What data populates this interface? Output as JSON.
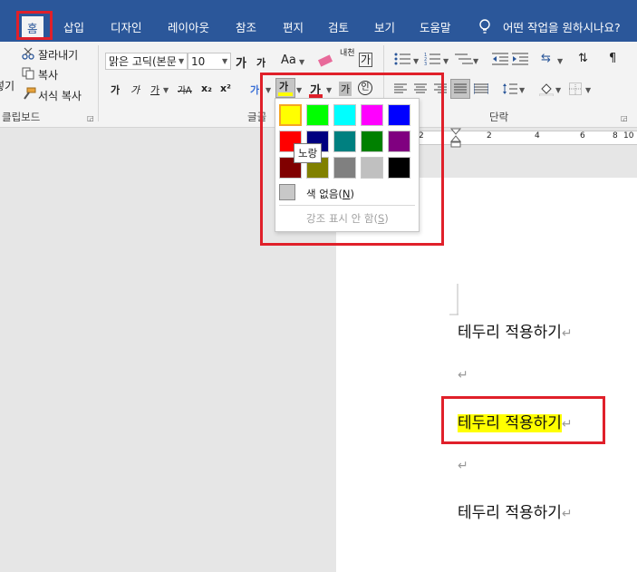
{
  "tabs": [
    {
      "label": "홈",
      "active": true
    },
    {
      "label": "삽입"
    },
    {
      "label": "디자인"
    },
    {
      "label": "레이아웃"
    },
    {
      "label": "참조"
    },
    {
      "label": "편지"
    },
    {
      "label": "검토"
    },
    {
      "label": "보기"
    },
    {
      "label": "도움말"
    }
  ],
  "tell_me": "어떤 작업을 원하시나요?",
  "clipboard": {
    "paste_partial": "넣기",
    "cut": "잘라내기",
    "copy": "복사",
    "format_painter": "서식 복사",
    "group_label": "클립보드"
  },
  "font": {
    "font_name": "맑은 고딕(본문",
    "font_size": "10",
    "group_label": "글꼴",
    "grow_label": "가",
    "shrink_label": "가",
    "case_label": "Aa",
    "bold": "가",
    "italic": "가",
    "underline": "가",
    "strike": "가Ꭺ",
    "subscript": "x₂",
    "superscript": "x²",
    "text_effect": "가",
    "highlight": "가",
    "font_color": "가",
    "char_shade": "가",
    "enclose": "인",
    "phonetic": "내천",
    "border_char": "가"
  },
  "paragraph": {
    "group_label": "단락"
  },
  "ruler_numbers": [
    "2",
    "2",
    "4",
    "6",
    "8",
    "10"
  ],
  "highlight_menu": {
    "colors": [
      {
        "name": "노랑",
        "hex": "#ffff00"
      },
      {
        "name": "밝은 녹색",
        "hex": "#00ff00"
      },
      {
        "name": "옥색",
        "hex": "#00ffff"
      },
      {
        "name": "분홍",
        "hex": "#ff00ff"
      },
      {
        "name": "파랑",
        "hex": "#0000ff"
      },
      {
        "name": "빨강",
        "hex": "#ff0000"
      },
      {
        "name": "진한 파랑",
        "hex": "#000080"
      },
      {
        "name": "청록",
        "hex": "#008080"
      },
      {
        "name": "녹색",
        "hex": "#008000"
      },
      {
        "name": "보라",
        "hex": "#800080"
      },
      {
        "name": "진한 빨강",
        "hex": "#800000"
      },
      {
        "name": "진한 노랑",
        "hex": "#808000"
      },
      {
        "name": "회색 50%",
        "hex": "#808080"
      },
      {
        "name": "회색 25%",
        "hex": "#c0c0c0"
      },
      {
        "name": "검정",
        "hex": "#000000"
      }
    ],
    "tooltip": "노랑",
    "no_color": "색 없음(",
    "no_color_key": "N",
    "stop_highlight": "강조 표시 안 함(",
    "stop_highlight_key": "S"
  },
  "document": {
    "lines": [
      {
        "text": "테두리 적용하기",
        "highlighted": false
      },
      {
        "text": "",
        "highlighted": false
      },
      {
        "text": "테두리 적용하기",
        "highlighted": true
      },
      {
        "text": "",
        "highlighted": false
      },
      {
        "text": "테두리 적용하기",
        "highlighted": false
      }
    ],
    "paragraph_mark": "↵"
  },
  "colors": {
    "ribbon_blue": "#2b579a",
    "annotation_red": "#e0202a",
    "highlight_yellow": "#ffff00"
  }
}
